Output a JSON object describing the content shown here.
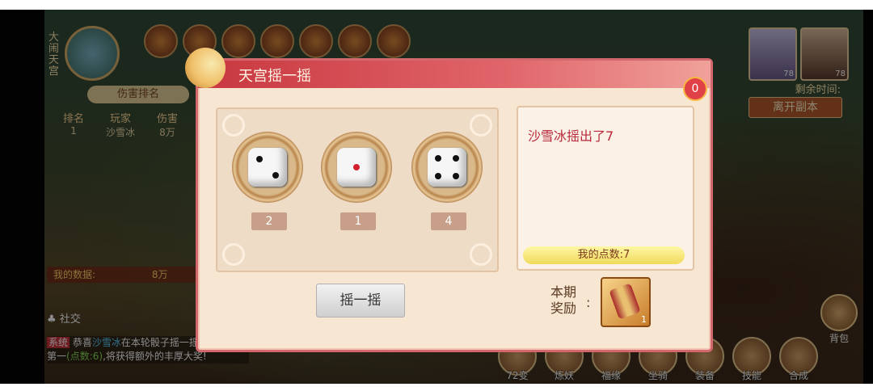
{
  "hud": {
    "map_name": "大闹天宫",
    "rank_title": "伤害排名",
    "rank_headers": [
      "排名",
      "玩家",
      "伤害"
    ],
    "rank_rows": [
      [
        "1",
        "沙雪冰",
        "8万"
      ]
    ],
    "my_data_label": "我的数据:",
    "my_data_value": "8万",
    "social": "社交",
    "remain_time_label": "剩余时间:",
    "leave_button": "离开副本",
    "portrait_levels": [
      "78",
      "78"
    ],
    "bag": "背包",
    "bottom_menu": [
      "72变",
      "炼妖",
      "福缘",
      "坐骑",
      "装备",
      "技能",
      "合成"
    ]
  },
  "chat": {
    "tag": "系统",
    "pre": "恭喜",
    "player": "沙雪冰",
    "mid": "在本轮骰子摇一摇活动中荣获第一",
    "points": "(点数:6)",
    "post": ",将获得额外的丰厚大奖!"
  },
  "dialog": {
    "title": "天宫摇一摇",
    "badge_count": "0",
    "dice": [
      {
        "value": "2"
      },
      {
        "value": "1"
      },
      {
        "value": "4"
      }
    ],
    "result_text": "沙雪冰摇出了7",
    "my_points": "我的点数:7",
    "shake_button": "摇一摇",
    "reward_label_line1": "本期",
    "reward_label_line2": "奖励",
    "reward_colon": ":",
    "reward_quantity": "1"
  }
}
